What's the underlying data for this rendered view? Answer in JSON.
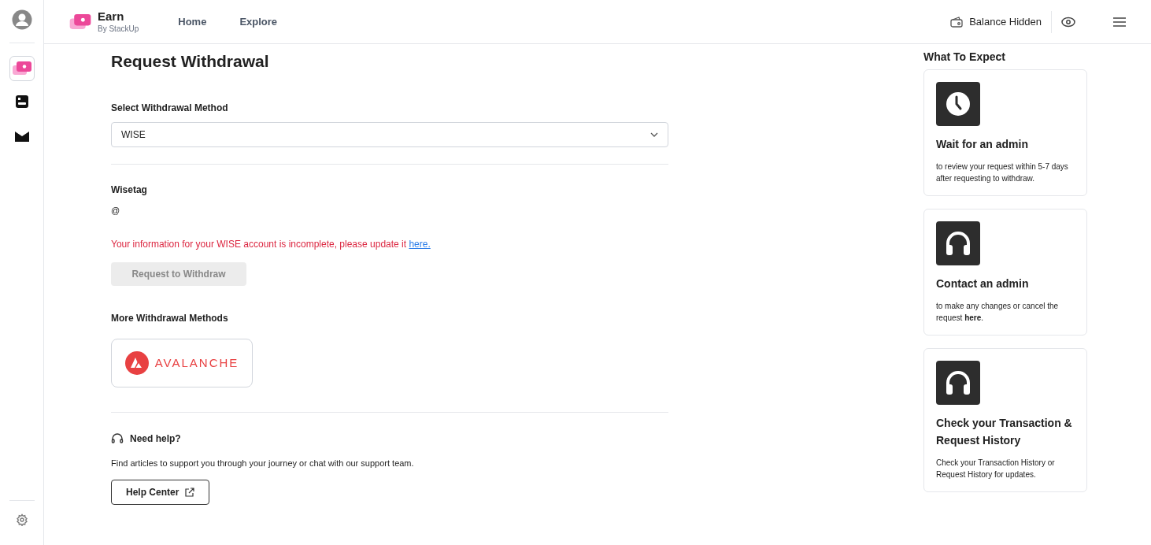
{
  "sidebar": {
    "items": [
      {
        "kind": "earn",
        "selected": true
      },
      {
        "kind": "wallet",
        "selected": false
      },
      {
        "kind": "mail",
        "selected": false
      }
    ]
  },
  "header": {
    "brand": "Earn",
    "brand_sub": "By StackUp",
    "nav": [
      "Home",
      "Explore"
    ],
    "balance": "Balance Hidden"
  },
  "main": {
    "title": "Request Withdrawal",
    "method_label": "Select Withdrawal Method",
    "method_value": "WISE",
    "wisetag_label": "Wisetag",
    "wisetag_value": "@",
    "error": "Your information for your WISE account is incomplete, please update it",
    "error_link": "here.",
    "request_button": {
      "label": "Request to Withdraw",
      "disabled": true
    },
    "more_label": "More Withdrawal Methods",
    "avalanche": "AVALANCHE",
    "help_title": "Need help?",
    "help_text": "Find articles to support you through your journey or chat with our support team.",
    "help_button": "Help Center"
  },
  "expect": {
    "title": "What To Expect",
    "cards": [
      {
        "kind": "clock",
        "title": "Wait for an admin",
        "text": "to review your request within 5-7 days after requesting to withdraw."
      },
      {
        "kind": "headphones",
        "title": "Contact an admin",
        "text": "to make any changes or cancel the request **here**."
      },
      {
        "kind": "headphones",
        "title": "Check your Transaction & Request History",
        "text": "Check your Transaction History or Request History for updates."
      }
    ]
  }
}
